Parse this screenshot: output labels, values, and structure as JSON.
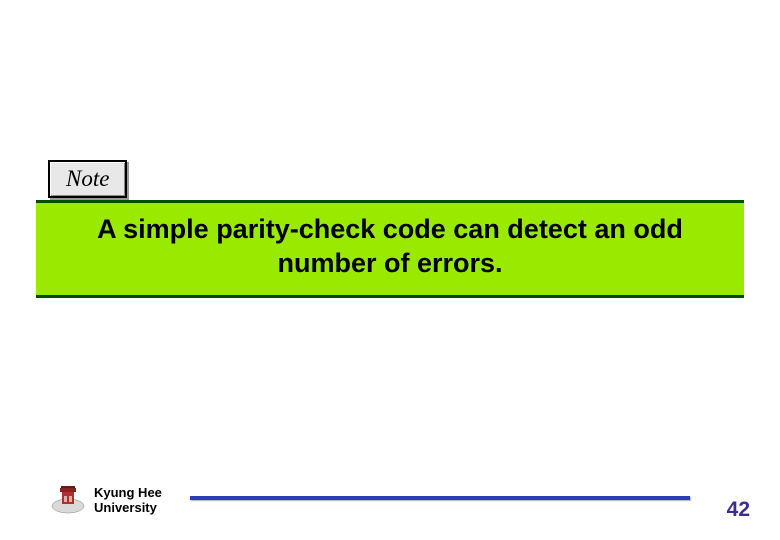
{
  "note": {
    "label": "Note"
  },
  "main": {
    "text": "A simple parity-check code can detect an odd number of errors."
  },
  "footer": {
    "university_line1": "Kyung Hee",
    "university_line2": "University",
    "page_number": "42"
  }
}
